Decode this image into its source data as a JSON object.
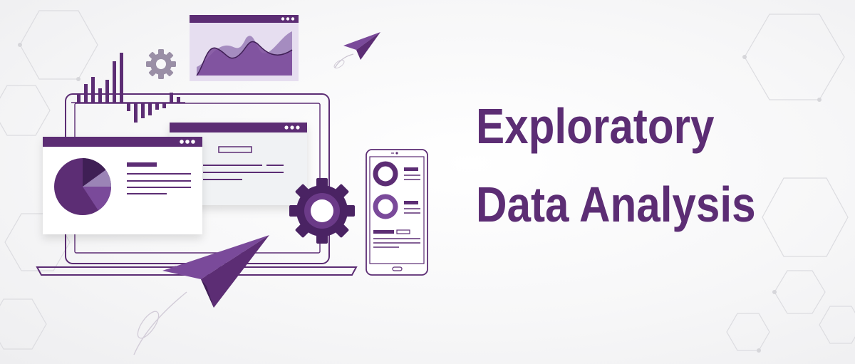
{
  "title": {
    "line1": "Exploratory",
    "line2": "Data Analysis"
  },
  "colors": {
    "brand": "#5c2d74",
    "brand_dark": "#4a2363",
    "brand_mid": "#7a4a9a",
    "brand_light": "#a58cc0",
    "brand_pale": "#e6def0",
    "window_bg": "#ffffff",
    "panel_bg": "#f0f2f4",
    "hex_lines": "#dcdce0"
  },
  "icons": [
    "bar-chart-icon",
    "gear-icon",
    "area-chart-window-icon",
    "paper-plane-icon",
    "laptop-icon",
    "pie-chart-window-icon",
    "document-window-icon",
    "smartphone-icon"
  ]
}
